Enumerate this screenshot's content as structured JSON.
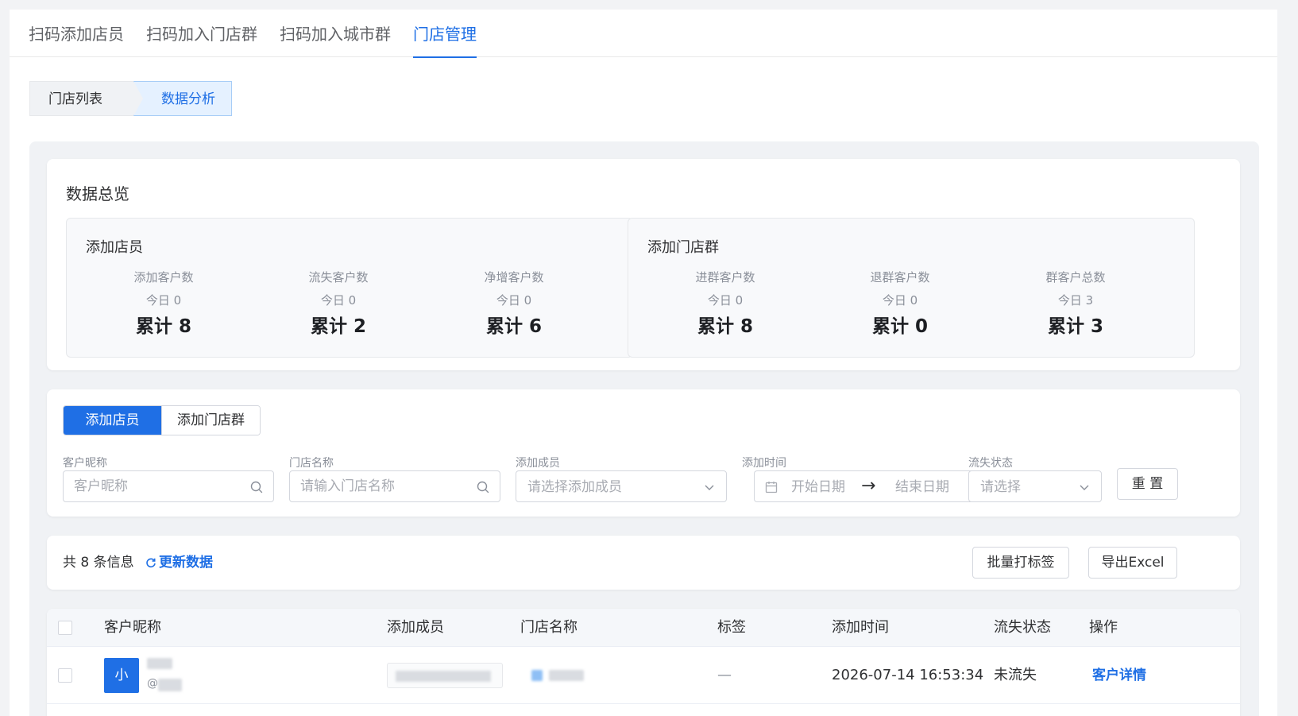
{
  "top_tabs": [
    {
      "label": "扫码添加店员"
    },
    {
      "label": "扫码加入门店群"
    },
    {
      "label": "扫码加入城市群"
    },
    {
      "label": "门店管理",
      "active": true
    }
  ],
  "sub_tabs": [
    {
      "label": "门店列表"
    },
    {
      "label": "数据分析",
      "active": true
    }
  ],
  "overview": {
    "title": "数据总览",
    "groups": [
      {
        "title": "添加店员",
        "metrics": [
          {
            "name": "添加客户数",
            "today": "今日 0",
            "total": "累计 8"
          },
          {
            "name": "流失客户数",
            "today": "今日 0",
            "total": "累计 2"
          },
          {
            "name": "净增客户数",
            "today": "今日 0",
            "total": "累计 6"
          }
        ]
      },
      {
        "title": "添加门店群",
        "metrics": [
          {
            "name": "进群客户数",
            "today": "今日 0",
            "total": "累计 8"
          },
          {
            "name": "退群客户数",
            "today": "今日 0",
            "total": "累计 0"
          },
          {
            "name": "群客户总数",
            "today": "今日 3",
            "total": "累计 3"
          }
        ]
      }
    ]
  },
  "filters": {
    "segment": [
      "添加店员",
      "添加门店群"
    ],
    "nickname": {
      "label": "客户昵称",
      "placeholder": "客户昵称"
    },
    "store": {
      "label": "门店名称",
      "placeholder": "请输入门店名称"
    },
    "member": {
      "label": "添加成员",
      "placeholder": "请选择添加成员"
    },
    "date": {
      "label": "添加时间",
      "start": "开始日期",
      "arrow": "→",
      "end": "结束日期"
    },
    "churn": {
      "label": "流失状态",
      "placeholder": "请选择"
    },
    "reset_label": "重 置"
  },
  "summary": {
    "count_text": "共 8 条信息",
    "refresh_label": "更新数据",
    "batch_tag_label": "批量打标签",
    "export_label": "导出Excel"
  },
  "table": {
    "columns": [
      "客户昵称",
      "添加成员",
      "门店名称",
      "标签",
      "添加时间",
      "流失状态",
      "操作"
    ],
    "rows": [
      {
        "avatar_text": "小",
        "nickname_sub": "@",
        "tag": "—",
        "time": "2026-07-14 16:53:34",
        "status": "未流失",
        "action": "客户详情"
      }
    ]
  },
  "colors": {
    "accent": "#1f6fe5",
    "text": "#303133",
    "muted": "#8a8f99"
  }
}
